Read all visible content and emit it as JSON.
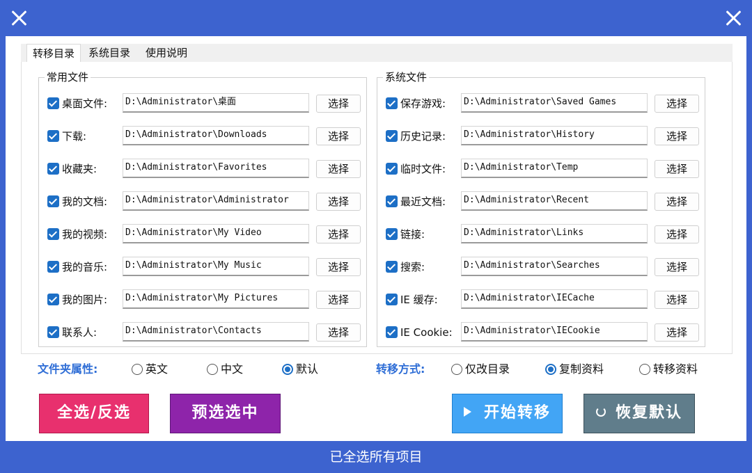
{
  "window": {
    "close_left_icon": "close-icon",
    "close_right_icon": "close-icon",
    "title_color": "#3d63cf"
  },
  "tabs": [
    {
      "label": "转移目录",
      "active": true
    },
    {
      "label": "系统目录",
      "active": false
    },
    {
      "label": "使用说明",
      "active": false
    }
  ],
  "common_files": {
    "title": "常用文件",
    "rows": [
      {
        "label": "桌面文件:",
        "checked": true,
        "path": "D:\\Administrator\\桌面",
        "button": "选择"
      },
      {
        "label": "下载:",
        "checked": true,
        "path": "D:\\Administrator\\Downloads",
        "button": "选择"
      },
      {
        "label": "收藏夹:",
        "checked": true,
        "path": "D:\\Administrator\\Favorites",
        "button": "选择"
      },
      {
        "label": "我的文档:",
        "checked": true,
        "path": "D:\\Administrator\\Administrator",
        "button": "选择"
      },
      {
        "label": "我的视频:",
        "checked": true,
        "path": "D:\\Administrator\\My Video",
        "button": "选择"
      },
      {
        "label": "我的音乐:",
        "checked": true,
        "path": "D:\\Administrator\\My Music",
        "button": "选择"
      },
      {
        "label": "我的图片:",
        "checked": true,
        "path": "D:\\Administrator\\My Pictures",
        "button": "选择"
      },
      {
        "label": "联系人:",
        "checked": true,
        "path": "D:\\Administrator\\Contacts",
        "button": "选择"
      }
    ]
  },
  "system_files": {
    "title": "系统文件",
    "rows": [
      {
        "label": "保存游戏:",
        "checked": true,
        "path": "D:\\Administrator\\Saved Games",
        "button": "选择"
      },
      {
        "label": "历史记录:",
        "checked": true,
        "path": "D:\\Administrator\\History",
        "button": "选择"
      },
      {
        "label": "临时文件:",
        "checked": true,
        "path": "D:\\Administrator\\Temp",
        "button": "选择"
      },
      {
        "label": "最近文档:",
        "checked": true,
        "path": "D:\\Administrator\\Recent",
        "button": "选择"
      },
      {
        "label": "链接:",
        "checked": true,
        "path": "D:\\Administrator\\Links",
        "button": "选择"
      },
      {
        "label": "搜索:",
        "checked": true,
        "path": "D:\\Administrator\\Searches",
        "button": "选择"
      },
      {
        "label": "IE 缓存:",
        "checked": true,
        "path": "D:\\Administrator\\IECache",
        "button": "选择"
      },
      {
        "label": "IE Cookie:",
        "checked": true,
        "path": "D:\\Administrator\\IECookie",
        "button": "选择"
      }
    ]
  },
  "folder_attr": {
    "label": "文件夹属性:",
    "options": [
      {
        "label": "英文",
        "selected": false
      },
      {
        "label": "中文",
        "selected": false
      },
      {
        "label": "默认",
        "selected": true
      }
    ]
  },
  "transfer_mode": {
    "label": "转移方式:",
    "options": [
      {
        "label": "仅改目录",
        "selected": false
      },
      {
        "label": "复制资料",
        "selected": true
      },
      {
        "label": "转移资料",
        "selected": false
      }
    ]
  },
  "buttons": {
    "select_all": {
      "label": "全选/反选",
      "color": "#e8306e"
    },
    "preselect": {
      "label": "预选选中",
      "color": "#8e24aa"
    },
    "start": {
      "label": "开始转移",
      "color": "#42a5f5",
      "icon": "play-icon"
    },
    "restore": {
      "label": "恢复默认",
      "color": "#607d8b",
      "icon": "refresh-icon"
    }
  },
  "status": {
    "text": "已全选所有项目"
  }
}
